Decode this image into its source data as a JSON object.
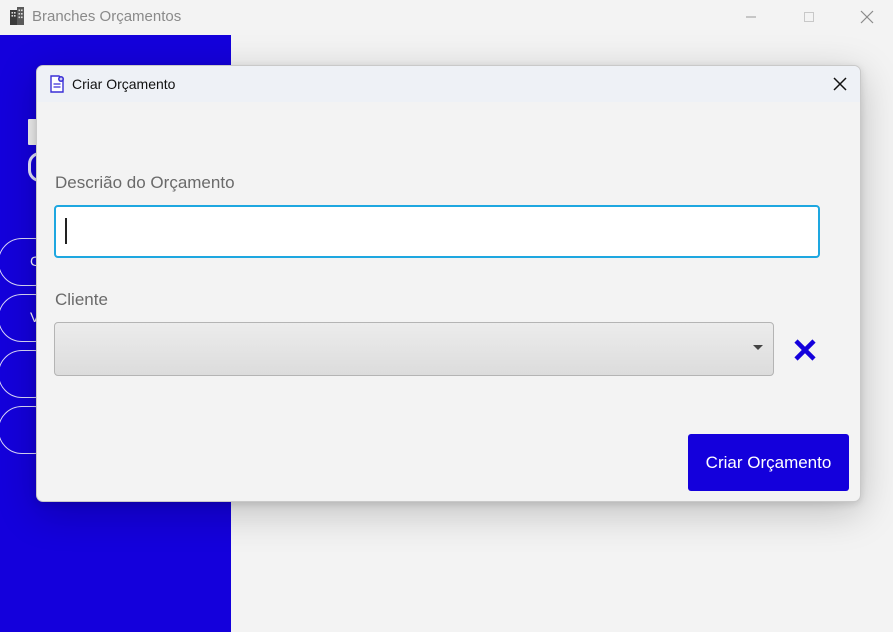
{
  "window": {
    "title": "Branches Orçamentos"
  },
  "sidebar": {
    "items": [
      {
        "label": "C"
      },
      {
        "label": "V"
      },
      {
        "label": ""
      },
      {
        "label": ""
      }
    ]
  },
  "dialog": {
    "title": "Criar Orçamento",
    "description_label": "Descrião do Orçamento",
    "description_value": "",
    "client_label": "Cliente",
    "client_selected": "",
    "submit_label": "Criar Orçamento"
  },
  "colors": {
    "accent": "#1400dc",
    "focus_border": "#1ea7e0",
    "background": "#f3f3f3"
  },
  "icons": {
    "app": "building-icon",
    "dialog": "document-icon",
    "close": "close-icon",
    "clear": "x-mark-icon",
    "dropdown": "chevron-down-icon"
  }
}
